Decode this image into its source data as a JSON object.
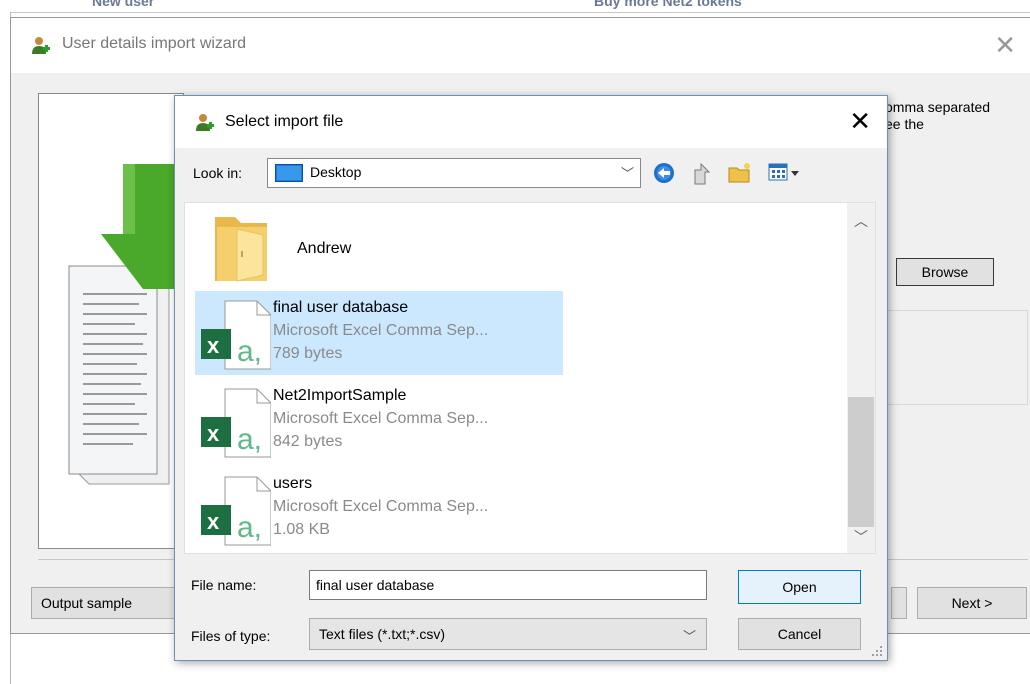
{
  "background": {
    "left_text": "New user",
    "right_text": "Buy more Net2 tokens"
  },
  "wizard": {
    "title": "User details import wizard",
    "close_glyph": "✕",
    "description": "omma separated\nee the",
    "browse_label": "Browse",
    "output_sample_label": "Output sample",
    "next_label": "Next >"
  },
  "dialog": {
    "title": "Select import file",
    "close_glyph": "✕",
    "look_in_label": "Look in:",
    "look_in_value": "Desktop",
    "chevron": "﹀",
    "toolbar_icons": [
      "back-icon",
      "up-folder-icon",
      "new-folder-icon",
      "view-menu-icon"
    ],
    "files": [
      {
        "name": "Andrew",
        "kind": "folder"
      },
      {
        "name": "final user database",
        "type": "Microsoft Excel Comma Sep...",
        "size": "789 bytes",
        "selected": true
      },
      {
        "name": "Net2ImportSample",
        "type": "Microsoft Excel Comma Sep...",
        "size": "842 bytes",
        "selected": false
      },
      {
        "name": "users",
        "type": "Microsoft Excel Comma Sep...",
        "size": "1.08 KB",
        "selected": false
      }
    ],
    "scroll_up_glyph": "︿",
    "scroll_down_glyph": "﹀",
    "file_name_label": "File name:",
    "file_name_value": "final user database",
    "file_type_label": "Files of type:",
    "file_type_value": "Text files (*.txt;*.csv)",
    "open_label": "Open",
    "cancel_label": "Cancel"
  },
  "colors": {
    "selection": "#cce8ff",
    "excel_green": "#1d6f42",
    "excel_a": "#5fb88a",
    "arrow_green": "#4aa82a",
    "folder_yellow": "#f5cf6b",
    "accent_blue": "#0078d7"
  }
}
